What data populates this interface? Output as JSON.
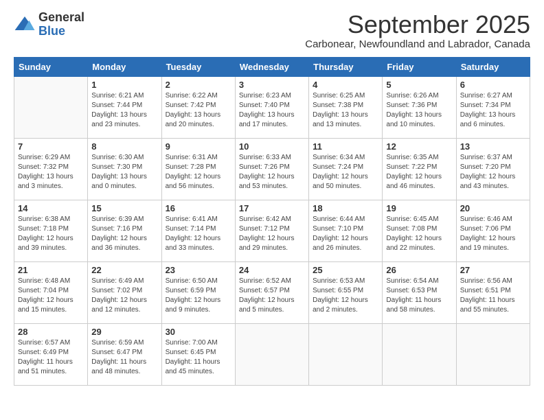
{
  "logo": {
    "general": "General",
    "blue": "Blue"
  },
  "title": "September 2025",
  "location": "Carbonear, Newfoundland and Labrador, Canada",
  "headers": [
    "Sunday",
    "Monday",
    "Tuesday",
    "Wednesday",
    "Thursday",
    "Friday",
    "Saturday"
  ],
  "weeks": [
    [
      {
        "day": "",
        "info": ""
      },
      {
        "day": "1",
        "info": "Sunrise: 6:21 AM\nSunset: 7:44 PM\nDaylight: 13 hours\nand 23 minutes."
      },
      {
        "day": "2",
        "info": "Sunrise: 6:22 AM\nSunset: 7:42 PM\nDaylight: 13 hours\nand 20 minutes."
      },
      {
        "day": "3",
        "info": "Sunrise: 6:23 AM\nSunset: 7:40 PM\nDaylight: 13 hours\nand 17 minutes."
      },
      {
        "day": "4",
        "info": "Sunrise: 6:25 AM\nSunset: 7:38 PM\nDaylight: 13 hours\nand 13 minutes."
      },
      {
        "day": "5",
        "info": "Sunrise: 6:26 AM\nSunset: 7:36 PM\nDaylight: 13 hours\nand 10 minutes."
      },
      {
        "day": "6",
        "info": "Sunrise: 6:27 AM\nSunset: 7:34 PM\nDaylight: 13 hours\nand 6 minutes."
      }
    ],
    [
      {
        "day": "7",
        "info": "Sunrise: 6:29 AM\nSunset: 7:32 PM\nDaylight: 13 hours\nand 3 minutes."
      },
      {
        "day": "8",
        "info": "Sunrise: 6:30 AM\nSunset: 7:30 PM\nDaylight: 13 hours\nand 0 minutes."
      },
      {
        "day": "9",
        "info": "Sunrise: 6:31 AM\nSunset: 7:28 PM\nDaylight: 12 hours\nand 56 minutes."
      },
      {
        "day": "10",
        "info": "Sunrise: 6:33 AM\nSunset: 7:26 PM\nDaylight: 12 hours\nand 53 minutes."
      },
      {
        "day": "11",
        "info": "Sunrise: 6:34 AM\nSunset: 7:24 PM\nDaylight: 12 hours\nand 50 minutes."
      },
      {
        "day": "12",
        "info": "Sunrise: 6:35 AM\nSunset: 7:22 PM\nDaylight: 12 hours\nand 46 minutes."
      },
      {
        "day": "13",
        "info": "Sunrise: 6:37 AM\nSunset: 7:20 PM\nDaylight: 12 hours\nand 43 minutes."
      }
    ],
    [
      {
        "day": "14",
        "info": "Sunrise: 6:38 AM\nSunset: 7:18 PM\nDaylight: 12 hours\nand 39 minutes."
      },
      {
        "day": "15",
        "info": "Sunrise: 6:39 AM\nSunset: 7:16 PM\nDaylight: 12 hours\nand 36 minutes."
      },
      {
        "day": "16",
        "info": "Sunrise: 6:41 AM\nSunset: 7:14 PM\nDaylight: 12 hours\nand 33 minutes."
      },
      {
        "day": "17",
        "info": "Sunrise: 6:42 AM\nSunset: 7:12 PM\nDaylight: 12 hours\nand 29 minutes."
      },
      {
        "day": "18",
        "info": "Sunrise: 6:44 AM\nSunset: 7:10 PM\nDaylight: 12 hours\nand 26 minutes."
      },
      {
        "day": "19",
        "info": "Sunrise: 6:45 AM\nSunset: 7:08 PM\nDaylight: 12 hours\nand 22 minutes."
      },
      {
        "day": "20",
        "info": "Sunrise: 6:46 AM\nSunset: 7:06 PM\nDaylight: 12 hours\nand 19 minutes."
      }
    ],
    [
      {
        "day": "21",
        "info": "Sunrise: 6:48 AM\nSunset: 7:04 PM\nDaylight: 12 hours\nand 15 minutes."
      },
      {
        "day": "22",
        "info": "Sunrise: 6:49 AM\nSunset: 7:02 PM\nDaylight: 12 hours\nand 12 minutes."
      },
      {
        "day": "23",
        "info": "Sunrise: 6:50 AM\nSunset: 6:59 PM\nDaylight: 12 hours\nand 9 minutes."
      },
      {
        "day": "24",
        "info": "Sunrise: 6:52 AM\nSunset: 6:57 PM\nDaylight: 12 hours\nand 5 minutes."
      },
      {
        "day": "25",
        "info": "Sunrise: 6:53 AM\nSunset: 6:55 PM\nDaylight: 12 hours\nand 2 minutes."
      },
      {
        "day": "26",
        "info": "Sunrise: 6:54 AM\nSunset: 6:53 PM\nDaylight: 11 hours\nand 58 minutes."
      },
      {
        "day": "27",
        "info": "Sunrise: 6:56 AM\nSunset: 6:51 PM\nDaylight: 11 hours\nand 55 minutes."
      }
    ],
    [
      {
        "day": "28",
        "info": "Sunrise: 6:57 AM\nSunset: 6:49 PM\nDaylight: 11 hours\nand 51 minutes."
      },
      {
        "day": "29",
        "info": "Sunrise: 6:59 AM\nSunset: 6:47 PM\nDaylight: 11 hours\nand 48 minutes."
      },
      {
        "day": "30",
        "info": "Sunrise: 7:00 AM\nSunset: 6:45 PM\nDaylight: 11 hours\nand 45 minutes."
      },
      {
        "day": "",
        "info": ""
      },
      {
        "day": "",
        "info": ""
      },
      {
        "day": "",
        "info": ""
      },
      {
        "day": "",
        "info": ""
      }
    ]
  ]
}
